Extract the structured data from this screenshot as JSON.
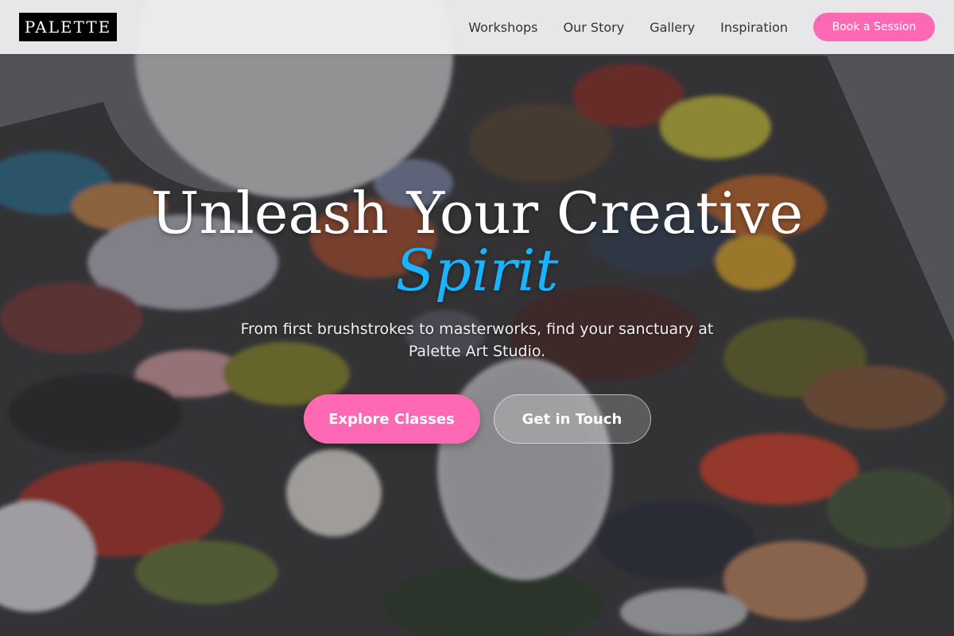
{
  "brand": {
    "logo_text": "PALETTE"
  },
  "nav": {
    "links": [
      "Workshops",
      "Our Story",
      "Gallery",
      "Inspiration"
    ],
    "cta_label": "Book a Session"
  },
  "hero": {
    "title": "Unleash Your Creative",
    "title_accent": "Spirit",
    "subtitle": "From first brushstrokes to masterworks, find your sanctuary at Palette Art Studio.",
    "primary_cta": "Explore Classes",
    "secondary_cta": "Get in Touch"
  },
  "colors": {
    "accent_pink": "#ff69b4",
    "accent_blue": "#19b3ff",
    "logo_bg": "#000000"
  },
  "icons": []
}
